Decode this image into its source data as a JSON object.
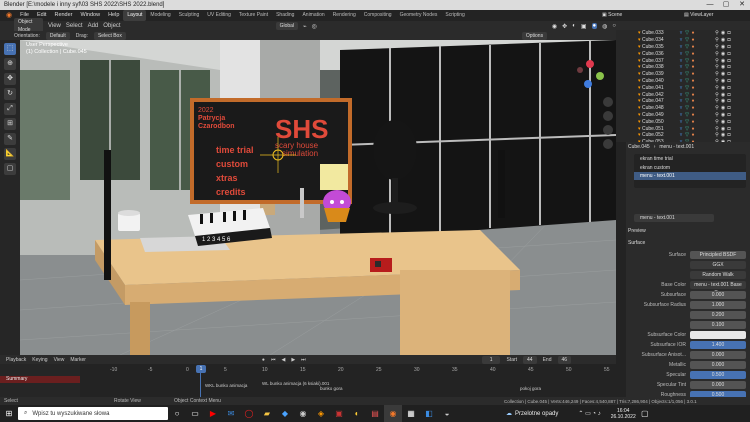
{
  "titlebar": {
    "title": "Blender [E:\\modele i inny syf\\03 SHS 2022\\SHS 2022.blend]",
    "minimize": "—",
    "maximize": "▢",
    "close": "✕"
  },
  "menubar": {
    "menus": [
      "File",
      "Edit",
      "Render",
      "Window",
      "Help"
    ],
    "workspaces": [
      "Layout",
      "Modeling",
      "Sculpting",
      "UV Editing",
      "Texture Paint",
      "Shading",
      "Animation",
      "Rendering",
      "Compositing",
      "Geometry Nodes",
      "Scripting"
    ],
    "active_workspace": "Layout",
    "scene_label": "Scene",
    "viewlayer_label": "ViewLayer"
  },
  "viewport_header": {
    "mode": "Object Mode",
    "view": "View",
    "select": "Select",
    "add": "Add",
    "object": "Object",
    "orientation": "Global",
    "options": "Options"
  },
  "viewport_header2": {
    "orientation_label": "Orientation:",
    "orientation_value": "Default",
    "drag_label": "Drag:",
    "drag_value": "Select Box"
  },
  "viewport_overlay": {
    "view_name": "User Perspective",
    "collection": "(1) Collection | Cube.045"
  },
  "scene_text": {
    "year": "2022",
    "author1": "Patrycja",
    "author2": "Czarodbon",
    "title": "SHS",
    "subtitle1": "scary house",
    "subtitle2": "simulation",
    "menu_items": [
      "time trial",
      "custom",
      "xtras",
      "credits"
    ],
    "keys": "1 2 3 4 5 6"
  },
  "outliner": {
    "rows": [
      "Cube.033",
      "Cube.034",
      "Cube.035",
      "Cube.036",
      "Cube.037",
      "Cube.038",
      "Cube.039",
      "Cube.040",
      "Cube.041",
      "Cube.042",
      "Cube.047",
      "Cube.048",
      "Cube.049",
      "Cube.050",
      "Cube.051",
      "Cube.052",
      "Cube.053"
    ]
  },
  "properties": {
    "object_name": "Cube.045",
    "material_name": "menu - text.001",
    "slots": [
      "ekran time trial",
      "ekran custom",
      "menu - text.001"
    ],
    "material_field": "menu - text.001",
    "preview_label": "Preview",
    "surface_panel": "Surface",
    "surface_label": "Surface",
    "surface_value": "Principled BSDF",
    "distribution": "GGX",
    "subsurface_method": "Random Walk",
    "base_color_label": "Base Color",
    "base_color_value": "menu - text.001 Base C...",
    "fields": [
      {
        "label": "Subsurface",
        "value": "0.000"
      },
      {
        "label": "Subsurface Radius",
        "value": "1.000"
      },
      {
        "label": "",
        "value": "0.200"
      },
      {
        "label": "",
        "value": "0.100"
      },
      {
        "label": "Subsurface Color",
        "value": ""
      },
      {
        "label": "Subsurface IOR",
        "value": "1.400"
      },
      {
        "label": "Subsurface Anisot...",
        "value": "0.000"
      },
      {
        "label": "Metallic",
        "value": "0.000"
      },
      {
        "label": "Specular",
        "value": "0.500"
      },
      {
        "label": "Specular Tint",
        "value": "0.000"
      },
      {
        "label": "Roughness",
        "value": "0.500"
      }
    ]
  },
  "timeline": {
    "playback": "Playback",
    "keying": "Keying",
    "view": "View",
    "marker": "Marker",
    "current_frame": "1",
    "start_label": "Start",
    "start": "44",
    "end_label": "End",
    "end": "46",
    "ticks": [
      "-10",
      "-5",
      "0",
      "5",
      "10",
      "15",
      "20",
      "25",
      "30",
      "35",
      "40",
      "45",
      "50",
      "55"
    ],
    "summary": "Summary",
    "markers": [
      "WKL bunko animacja",
      "WL bunko animacja (6 ksiaki).001",
      "bunko gora",
      "pokoj gora"
    ]
  },
  "statusbar": {
    "select": "Select",
    "rotate": "Rotate View",
    "context": "Object Context Menu",
    "stats": "Collection | Cube.045 | Verts:446,249 | Faces:4,540,887 | Tris:7,286,904 | Objects:1/1,056 | 3.0.1"
  },
  "taskbar": {
    "search_placeholder": "Wpisz tu wyszukiwane słowa",
    "weather": "Przelotne opady",
    "time": "16:04",
    "date": "26.10.2022"
  },
  "colors": {
    "accent": "#4772b3",
    "orange": "#f39c12",
    "sign_red": "#e04a3a",
    "board_bg": "#1a1a1a",
    "board_frame": "#c26b2a"
  }
}
